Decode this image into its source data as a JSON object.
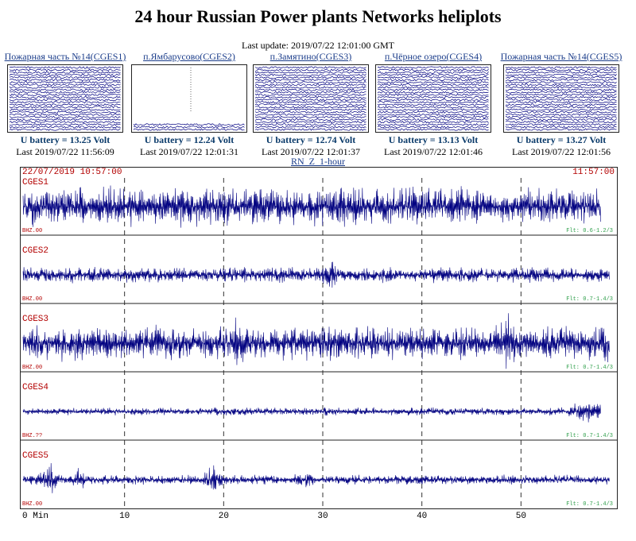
{
  "page": {
    "title": "24 hour Russian Power plants Networks heliplots",
    "last_update": "Last update: 2019/07/22 12:01:00 GMT"
  },
  "stations": [
    {
      "label": "Пожарная часть №14(CGES1)",
      "battery": "U battery = 13.25 Volt",
      "last": "Last 2019/07/22 11:56:09",
      "thumb_fill": 0.75
    },
    {
      "label": "п.Ямбарусово(CGES2)",
      "battery": "U battery = 12.24 Volt",
      "last": "Last 2019/07/22 12:01:31",
      "thumb_fill": 0.12
    },
    {
      "label": "п.Замятино(CGES3)",
      "battery": "U battery = 12.74 Volt",
      "last": "Last 2019/07/22 12:01:37",
      "thumb_fill": 0.85
    },
    {
      "label": "п.Чёрное озеро(CGES4)",
      "battery": "U battery = 13.13 Volt",
      "last": "Last 2019/07/22 12:01:46",
      "thumb_fill": 0.85
    },
    {
      "label": "Пожарная часть №14(CGES5)",
      "battery": "U battery = 13.27 Volt",
      "last": "Last 2019/07/22 12:01:56",
      "thumb_fill": 0.85
    }
  ],
  "main_plot": {
    "link": "RN_Z_1-hour",
    "start": "22/07/2019 10:57:00",
    "end": "11:57:00",
    "x_tick_labels": [
      "0 Min",
      "10",
      "20",
      "30",
      "40",
      "50"
    ],
    "traces": [
      {
        "name": "CGES1",
        "channel": "BHZ.00",
        "filter": "Flt: 0.6-1.2/3",
        "end_fraction": 0.985
      },
      {
        "name": "CGES2",
        "channel": "BHZ.00",
        "filter": "Flt: 0.7-1.4/3",
        "end_fraction": 1.0
      },
      {
        "name": "CGES3",
        "channel": "BHZ.00",
        "filter": "Flt: 0.7-1.4/3",
        "end_fraction": 1.0
      },
      {
        "name": "CGES4",
        "channel": "BHZ.??",
        "filter": "Flt: 0.7-1.4/3",
        "end_fraction": 0.985
      },
      {
        "name": "CGES5",
        "channel": "BHZ.00",
        "filter": "Flt: 0.7-1.4/3",
        "end_fraction": 1.0
      }
    ],
    "colors": {
      "trace": "#000080",
      "header": "#b30000",
      "filter": "#2e9e4a",
      "border": "#222222"
    }
  }
}
